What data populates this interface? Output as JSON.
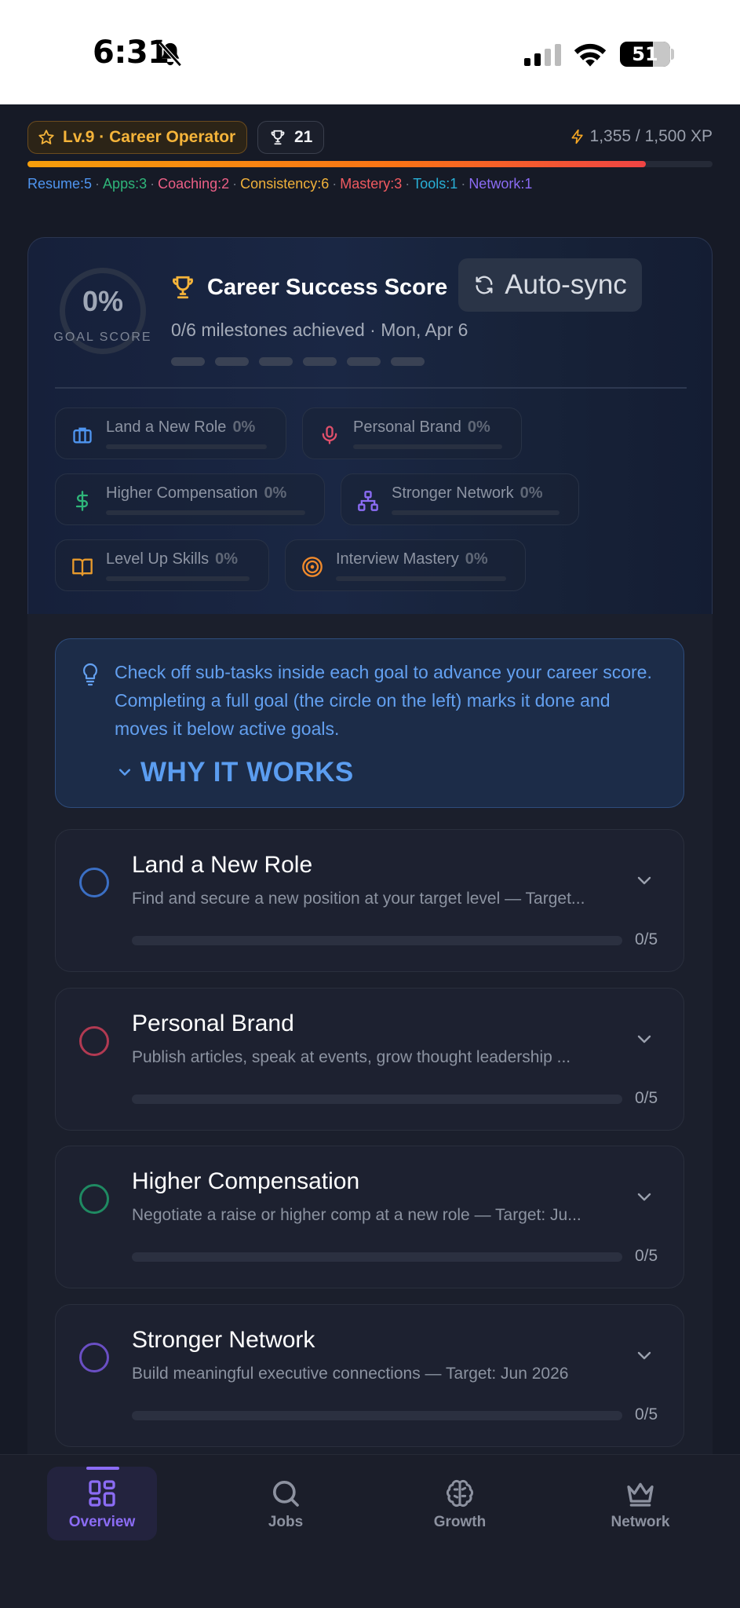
{
  "status_bar": {
    "time": "6:31",
    "battery": "51"
  },
  "header": {
    "level_badge": "Lv.9 · Career Operator",
    "trophies": "21",
    "xp": "1,355 / 1,500 XP",
    "xp_progress": 0.903,
    "skills": [
      {
        "label": "Resume:5",
        "color": "#4f95f0"
      },
      {
        "label": "Apps:3",
        "color": "#2fb67a"
      },
      {
        "label": "Coaching:2",
        "color": "#ec5f86"
      },
      {
        "label": "Consistency:6",
        "color": "#f0b13a"
      },
      {
        "label": "Mastery:3",
        "color": "#f05a60"
      },
      {
        "label": "Tools:1",
        "color": "#29b0d6"
      },
      {
        "label": "Network:1",
        "color": "#8b6cf4"
      }
    ]
  },
  "score_card": {
    "ring_value": "0%",
    "ring_label": "GOAL SCORE",
    "title": "Career Success Score",
    "autosync_label": "Auto-sync",
    "subtitle": "0/6 milestones achieved · Mon, Apr 6",
    "chips": [
      {
        "label": "Land a New Role",
        "pct": "0%",
        "icon": "briefcase-icon",
        "color": "#4f95f0"
      },
      {
        "label": "Personal Brand",
        "pct": "0%",
        "icon": "microphone-icon",
        "color": "#e0506b"
      },
      {
        "label": "Higher Compensation",
        "pct": "0%",
        "icon": "dollar-icon",
        "color": "#2fb67a"
      },
      {
        "label": "Stronger Network",
        "pct": "0%",
        "icon": "network-icon",
        "color": "#8b6cf4"
      },
      {
        "label": "Level Up Skills",
        "pct": "0%",
        "icon": "book-icon",
        "color": "#e89a2c"
      },
      {
        "label": "Interview Mastery",
        "pct": "0%",
        "icon": "target-icon",
        "color": "#f08a2c"
      }
    ]
  },
  "tip": {
    "text": "Check off sub-tasks inside each goal to advance your career score. Completing a full goal (the circle on the left) marks it done and moves it below active goals.",
    "why_label": "WHY IT WORKS"
  },
  "goals": [
    {
      "title": "Land a New Role",
      "desc": "Find and secure a new position at your target level — Target...",
      "count": "0/5",
      "progress": 0,
      "color": "#3b6fc4"
    },
    {
      "title": "Personal Brand",
      "desc": "Publish articles, speak at events, grow thought leadership ...",
      "count": "0/5",
      "progress": 0,
      "color": "#b23a52"
    },
    {
      "title": "Higher Compensation",
      "desc": "Negotiate a raise or higher comp at a new role — Target: Ju...",
      "count": "0/5",
      "progress": 0,
      "color": "#1f8a62"
    },
    {
      "title": "Stronger Network",
      "desc": "Build meaningful executive connections — Target: Jun 2026",
      "count": "0/5",
      "progress": 0,
      "color": "#6a4fc4"
    }
  ],
  "nav": [
    {
      "label": "Overview",
      "icon": "overview-icon",
      "active": true
    },
    {
      "label": "Jobs",
      "icon": "search-icon",
      "active": false
    },
    {
      "label": "Growth",
      "icon": "brain-icon",
      "active": false
    },
    {
      "label": "Network",
      "icon": "crown-icon",
      "active": false
    }
  ]
}
